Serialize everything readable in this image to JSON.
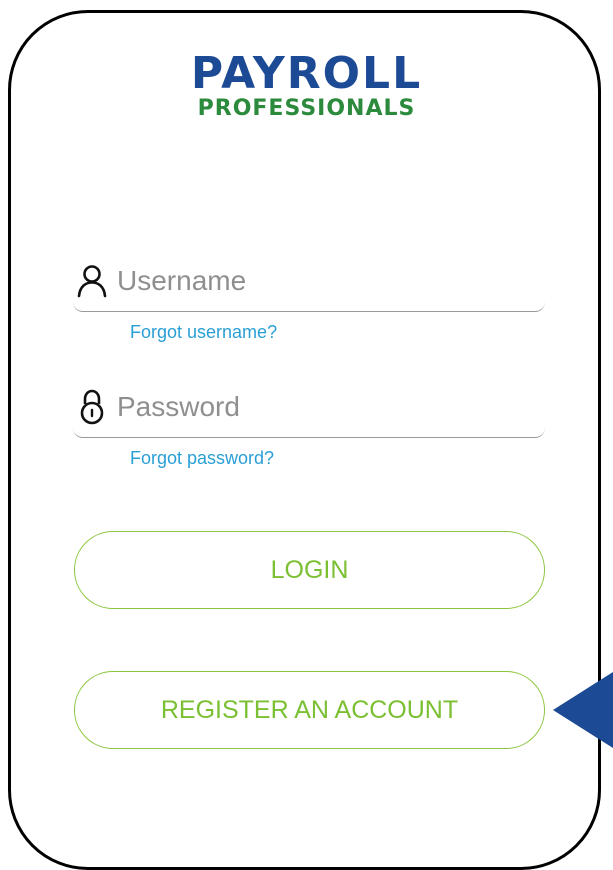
{
  "logo": {
    "line1": "PAYROLL",
    "line2": "PROFESSIONALS"
  },
  "username": {
    "placeholder": "Username",
    "icon": "user-icon",
    "forgot_label": "Forgot username?"
  },
  "password": {
    "placeholder": "Password",
    "icon": "lock-icon",
    "forgot_label": "Forgot password?"
  },
  "buttons": {
    "login_label": "LOGIN",
    "register_label": "REGISTER AN ACCOUNT"
  },
  "colors": {
    "brand_blue": "#1c4a94",
    "brand_green": "#2c8a3c",
    "link": "#2a9fd6",
    "button_accent": "#8cc63f",
    "pointer": "#1c4a94"
  }
}
